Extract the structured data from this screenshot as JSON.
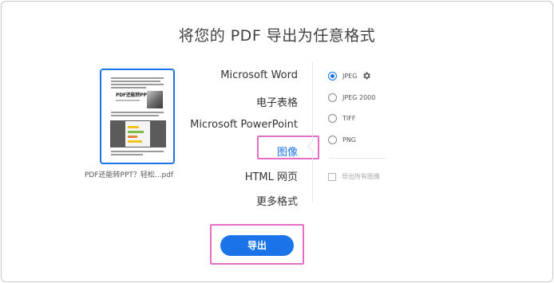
{
  "dialog": {
    "title": "将您的 PDF 导出为任意格式"
  },
  "file": {
    "name": "PDF还能转PPT？轻松...pdf",
    "thumbnail_heading": "PDF还能转PPT？"
  },
  "formats": [
    {
      "label": "Microsoft Word",
      "selected": false
    },
    {
      "label": "电子表格",
      "selected": false
    },
    {
      "label": "Microsoft PowerPoint",
      "selected": false
    },
    {
      "label": "图像",
      "selected": true
    },
    {
      "label": "HTML 网页",
      "selected": false
    },
    {
      "label": "更多格式",
      "selected": false
    }
  ],
  "image_options": [
    {
      "label": "JPEG",
      "selected": true,
      "has_settings": true,
      "settings_icon": "gear-icon"
    },
    {
      "label": "JPEG 2000",
      "selected": false
    },
    {
      "label": "TIFF",
      "selected": false
    },
    {
      "label": "PNG",
      "selected": false
    }
  ],
  "export_all_images": {
    "label": "导出所有图像",
    "checked": false,
    "enabled": false
  },
  "export_button": {
    "label": "导出"
  },
  "colors": {
    "accent": "#1a73e8",
    "highlight": "#e66fc6"
  }
}
